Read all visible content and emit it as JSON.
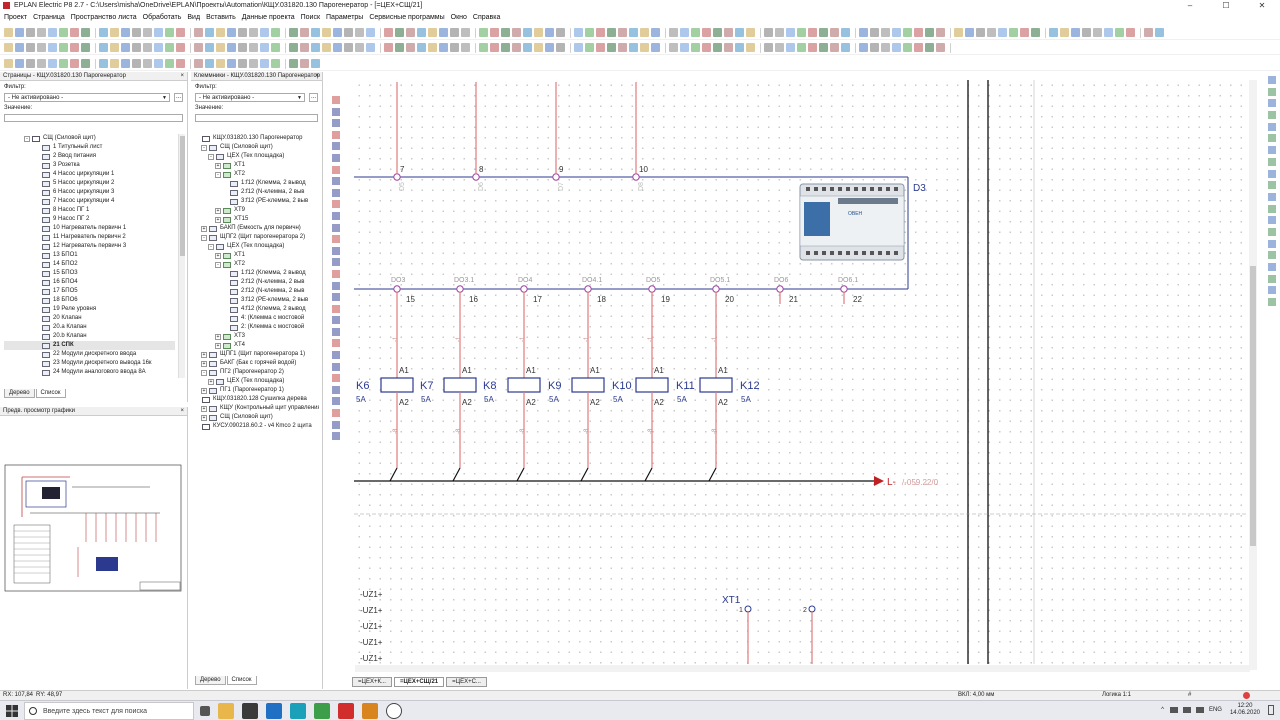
{
  "window": {
    "title": "EPLAN Electric P8 2.7 - C:\\Users\\misha\\OneDrive\\EPLAN\\Проекты\\Automation\\КЩУ.031820.130 Парогенератор - [=ЦЕХ+СЩ/21]",
    "minimize": "–",
    "maximize": "☐",
    "close": "✕"
  },
  "menu": [
    "Проект",
    "Страница",
    "Пространство листа",
    "Обработать",
    "Вид",
    "Вставить",
    "Данные проекта",
    "Поиск",
    "Параметры",
    "Сервисные программы",
    "Окно",
    "Справка"
  ],
  "pages_panel": {
    "title": "Страницы - КЩУ.031820.130 Парогенератор",
    "close": "×",
    "filter_label": "Фильтр:",
    "filter_value": "- Не активировано -",
    "dots": "...",
    "value_label": "Значение:",
    "tree_root": "СЩ (Силовой щит)",
    "pages": [
      "1 Титульный лист",
      "2 Ввод питания",
      "3 Розетка",
      "4 Насос циркуляции 1",
      "5 Насос циркуляции 2",
      "6 Насос циркуляции 3",
      "7 Насос циркуляции 4",
      "8 Насос ПГ 1",
      "9 Насос ПГ 2",
      "10 Нагреватель первичн 1",
      "11 Нагреватель первичн 2",
      "12 Нагреватель первичн 3",
      "13 БПО1",
      "14 БПО2",
      "15 БПО3",
      "16 БПО4",
      "17 БПО5",
      "18 БПО6",
      "19 Реле уровня",
      "20 Клапан",
      "20.a Клапан",
      "20.b Клапан",
      "21 СПК",
      "22 Модули дискретного ввода",
      "23 Модули дискретного вывода 16к",
      "24 Модули аналогового ввода 8А"
    ],
    "selected_page": "21 СПК",
    "tab_tree": "Дерево",
    "tab_list": "Список"
  },
  "preview_panel": {
    "title": "Предв. просмотр графики",
    "close": "×"
  },
  "terminals_panel": {
    "title": "Клеммники - КЩУ.031820.130 Парогенератор",
    "close": "×",
    "filter_label": "Фильтр:",
    "filter_value": "- Не активировано -",
    "dots": "...",
    "value_label": "Значение:",
    "tree": [
      {
        "t": "КЩУ.031820.130 Парогенератор",
        "lvl": 0,
        "exp": "",
        "ico": "doc"
      },
      {
        "t": "СЩ (Силовой щит)",
        "lvl": 1,
        "exp": "-",
        "ico": "box"
      },
      {
        "t": "ЦЕХ (Тех площадка)",
        "lvl": 2,
        "exp": "-",
        "ico": "box"
      },
      {
        "t": "XT1",
        "lvl": 3,
        "exp": "+",
        "ico": "grn"
      },
      {
        "t": "XT2",
        "lvl": 3,
        "exp": "-",
        "ico": "grn"
      },
      {
        "t": "1:f12 (Клемма, 2 вывод",
        "lvl": 4,
        "exp": "",
        "ico": "term"
      },
      {
        "t": "2:f12 (N-клемма, 2 выв",
        "lvl": 4,
        "exp": "",
        "ico": "term"
      },
      {
        "t": "3:f12 (PE-клемма, 2 выв",
        "lvl": 4,
        "exp": "",
        "ico": "term"
      },
      {
        "t": "XT9",
        "lvl": 3,
        "exp": "+",
        "ico": "grn"
      },
      {
        "t": "XT15",
        "lvl": 3,
        "exp": "+",
        "ico": "grn"
      },
      {
        "t": "БАКП (Емкость для первичн)",
        "lvl": 1,
        "exp": "+",
        "ico": "box"
      },
      {
        "t": "ЩПГ2 (Щит парогенератора 2)",
        "lvl": 1,
        "exp": "-",
        "ico": "box"
      },
      {
        "t": "ЦЕХ (Тех площадка)",
        "lvl": 2,
        "exp": "-",
        "ico": "box"
      },
      {
        "t": "XT1",
        "lvl": 3,
        "exp": "+",
        "ico": "grn"
      },
      {
        "t": "XT2",
        "lvl": 3,
        "exp": "-",
        "ico": "grn"
      },
      {
        "t": "1:f12 (Клемма, 2 вывод",
        "lvl": 4,
        "exp": "",
        "ico": "term"
      },
      {
        "t": "2:f12 (N-клемма, 2 выв",
        "lvl": 4,
        "exp": "",
        "ico": "term"
      },
      {
        "t": "2:f12 (N-клемма, 2 выв",
        "lvl": 4,
        "exp": "",
        "ico": "term"
      },
      {
        "t": "3:f12 (PE-клемма, 2 выв",
        "lvl": 4,
        "exp": "",
        "ico": "term"
      },
      {
        "t": "4:f12 (Клемма, 2 вывод",
        "lvl": 4,
        "exp": "",
        "ico": "term"
      },
      {
        "t": "4: (Клемма с мостовой",
        "lvl": 4,
        "exp": "",
        "ico": "term"
      },
      {
        "t": "2: (Клемма с мостовой",
        "lvl": 4,
        "exp": "",
        "ico": "term"
      },
      {
        "t": "XT3",
        "lvl": 3,
        "exp": "+",
        "ico": "grn"
      },
      {
        "t": "XT4",
        "lvl": 3,
        "exp": "+",
        "ico": "grn"
      },
      {
        "t": "ЩПГ1 (Щит парогенератора 1)",
        "lvl": 1,
        "exp": "+",
        "ico": "box"
      },
      {
        "t": "БАКГ (Бак с горячей водой)",
        "lvl": 1,
        "exp": "+",
        "ico": "box"
      },
      {
        "t": "ПГ2 (Парогенератор 2)",
        "lvl": 1,
        "exp": "-",
        "ico": "box"
      },
      {
        "t": "ЦЕХ (Тех площадка)",
        "lvl": 2,
        "exp": "+",
        "ico": "box"
      },
      {
        "t": "ПГ1 (Парогенератор 1)",
        "lvl": 1,
        "exp": "+",
        "ico": "box"
      },
      {
        "t": "КЩУ.031820.128 Сушилка дерева",
        "lvl": 0,
        "exp": "",
        "ico": "doc"
      },
      {
        "t": "КЩУ (Контрольный щит управления",
        "lvl": 1,
        "exp": "+",
        "ico": "box"
      },
      {
        "t": "СЩ (Силовой щит)",
        "lvl": 1,
        "exp": "+",
        "ico": "box"
      },
      {
        "t": "КУСУ.090218.60.2 - v4 Кmco 2 щита",
        "lvl": 0,
        "exp": "",
        "ico": "doc"
      }
    ],
    "tab_tree": "Дерево",
    "tab_list": "Список"
  },
  "schematic": {
    "top_terms": [
      "7",
      "8",
      "9",
      "10"
    ],
    "top_labels": [
      "D5",
      "D6",
      "D7",
      "D8"
    ],
    "plc_tag": "D3",
    "plc_brand": "ОВЕН",
    "mid_labels": [
      "DO3",
      "DO3.1",
      "DO4",
      "DO4.1",
      "DO5",
      "DO5.1",
      "DO6",
      "DO6.1"
    ],
    "mid_terms": [
      "15",
      "16",
      "17",
      "18",
      "19",
      "20",
      "21",
      "22"
    ],
    "relays": [
      {
        "tag": "K6",
        "rating": "5A"
      },
      {
        "tag": "K7",
        "rating": "5A"
      },
      {
        "tag": "K8",
        "rating": "5A"
      },
      {
        "tag": "K9",
        "rating": "5A"
      },
      {
        "tag": "K10",
        "rating": "5A"
      },
      {
        "tag": "K11",
        "rating": "5A"
      },
      {
        "tag": "K12",
        "rating": "5A"
      }
    ],
    "coil_top": "A1",
    "coil_bot": "A2",
    "wire_mark_top": "-1",
    "wire_mark_bot": "-8",
    "bus_label": "L-",
    "bus_ref": "/-059.22/0",
    "uz_labels": [
      "-UZ1+",
      "-UZ1+",
      "-UZ1+",
      "-UZ1+",
      "-UZ1+"
    ],
    "xt_tag": "XT1",
    "xt_terms": [
      "1",
      "2"
    ]
  },
  "bottom_tabs": [
    "=ЦЕХ+К...",
    "=ЦЕХ+СЩ/21",
    "=ЦЕХ+С..."
  ],
  "status": {
    "rx": "RX: 107,84",
    "ry": "RY: 48,97",
    "grid": "ВКЛ: 4,00 мм",
    "logic": "Логика 1:1",
    "hash": "#"
  },
  "taskbar": {
    "search_placeholder": "Введите здесь текст для поиска",
    "lang": "ENG",
    "time": "12:20",
    "date": "14.06.2020"
  },
  "colors": {
    "accent": "#c0262d",
    "wire": "#e07c7c",
    "symbol": "#2b3a8f",
    "bus": "#111111",
    "ref": "#c02020"
  }
}
